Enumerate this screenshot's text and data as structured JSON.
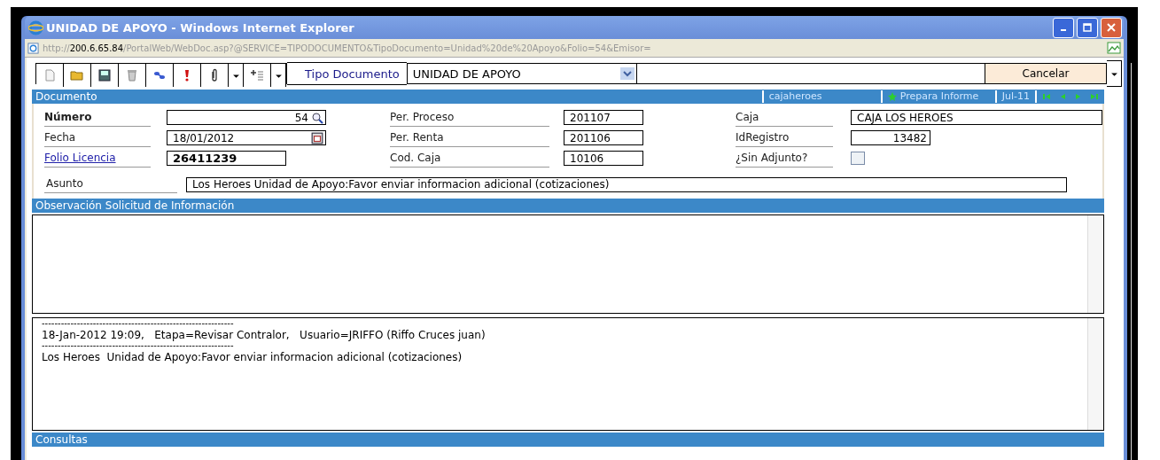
{
  "window": {
    "title": "UNIDAD DE APOYO - Windows Internet Explorer"
  },
  "address": {
    "scheme": "http://",
    "host": "200.6.65.84",
    "path": "/PortalWeb/WebDoc.asp?@SERVICE=TIPODOCUMENTO&TipoDocumento=Unidad%20de%20Apoyo&Folio=54&Emisor="
  },
  "toolbar": {
    "tools": [
      {
        "kind": "new"
      },
      {
        "kind": "open"
      },
      {
        "kind": "save"
      },
      {
        "kind": "trash"
      },
      {
        "kind": "link"
      },
      {
        "kind": "alert"
      },
      {
        "kind": "attach"
      },
      {
        "kind": "caret"
      },
      {
        "kind": "list"
      },
      {
        "kind": "caret"
      }
    ],
    "type_label": "Tipo Documento",
    "type_value": "UNIDAD DE APOYO",
    "action": "Cancelar"
  },
  "document_bar": {
    "title": "Documento",
    "user": "cajaheroes",
    "task": "Prepara Informe",
    "period": "Jul-11"
  },
  "fields": [
    {
      "label": "Número",
      "value": "54",
      "kind": "search",
      "bold": true
    },
    {
      "label": "Per. Proceso",
      "value": "201107",
      "kind": "plain"
    },
    {
      "label": "Caja",
      "value": "CAJA LOS HEROES",
      "kind": "wide"
    },
    {
      "label": "Fecha",
      "value": "18/01/2012",
      "kind": "date"
    },
    {
      "label": "Per. Renta",
      "value": "201106",
      "kind": "plain"
    },
    {
      "label": "IdRegistro",
      "value": "13482",
      "kind": "right"
    },
    {
      "label": "Folio Licencia",
      "value": "26411239",
      "kind": "link"
    },
    {
      "label": "Cod. Caja",
      "value": "10106",
      "kind": "plain"
    },
    {
      "label": "¿Sin Adjunto?",
      "kind": "check",
      "checked": false
    }
  ],
  "subject": {
    "label": "Asunto",
    "value": "Los Heroes  Unidad de Apoyo:Favor enviar informacion adicional (cotizaciones)"
  },
  "observation": {
    "title": "Observación Solicitud de Información"
  },
  "log": [
    "------------------------------------------------------------",
    "18-Jan-2012 19:09,   Etapa=Revisar Contralor,   Usuario=JRIFFO (Riffo Cruces juan)",
    "------------------------------------------------------------",
    "Los Heroes  Unidad de Apoyo:Favor enviar informacion adicional (cotizaciones)"
  ],
  "queries": {
    "title": "Consultas"
  }
}
